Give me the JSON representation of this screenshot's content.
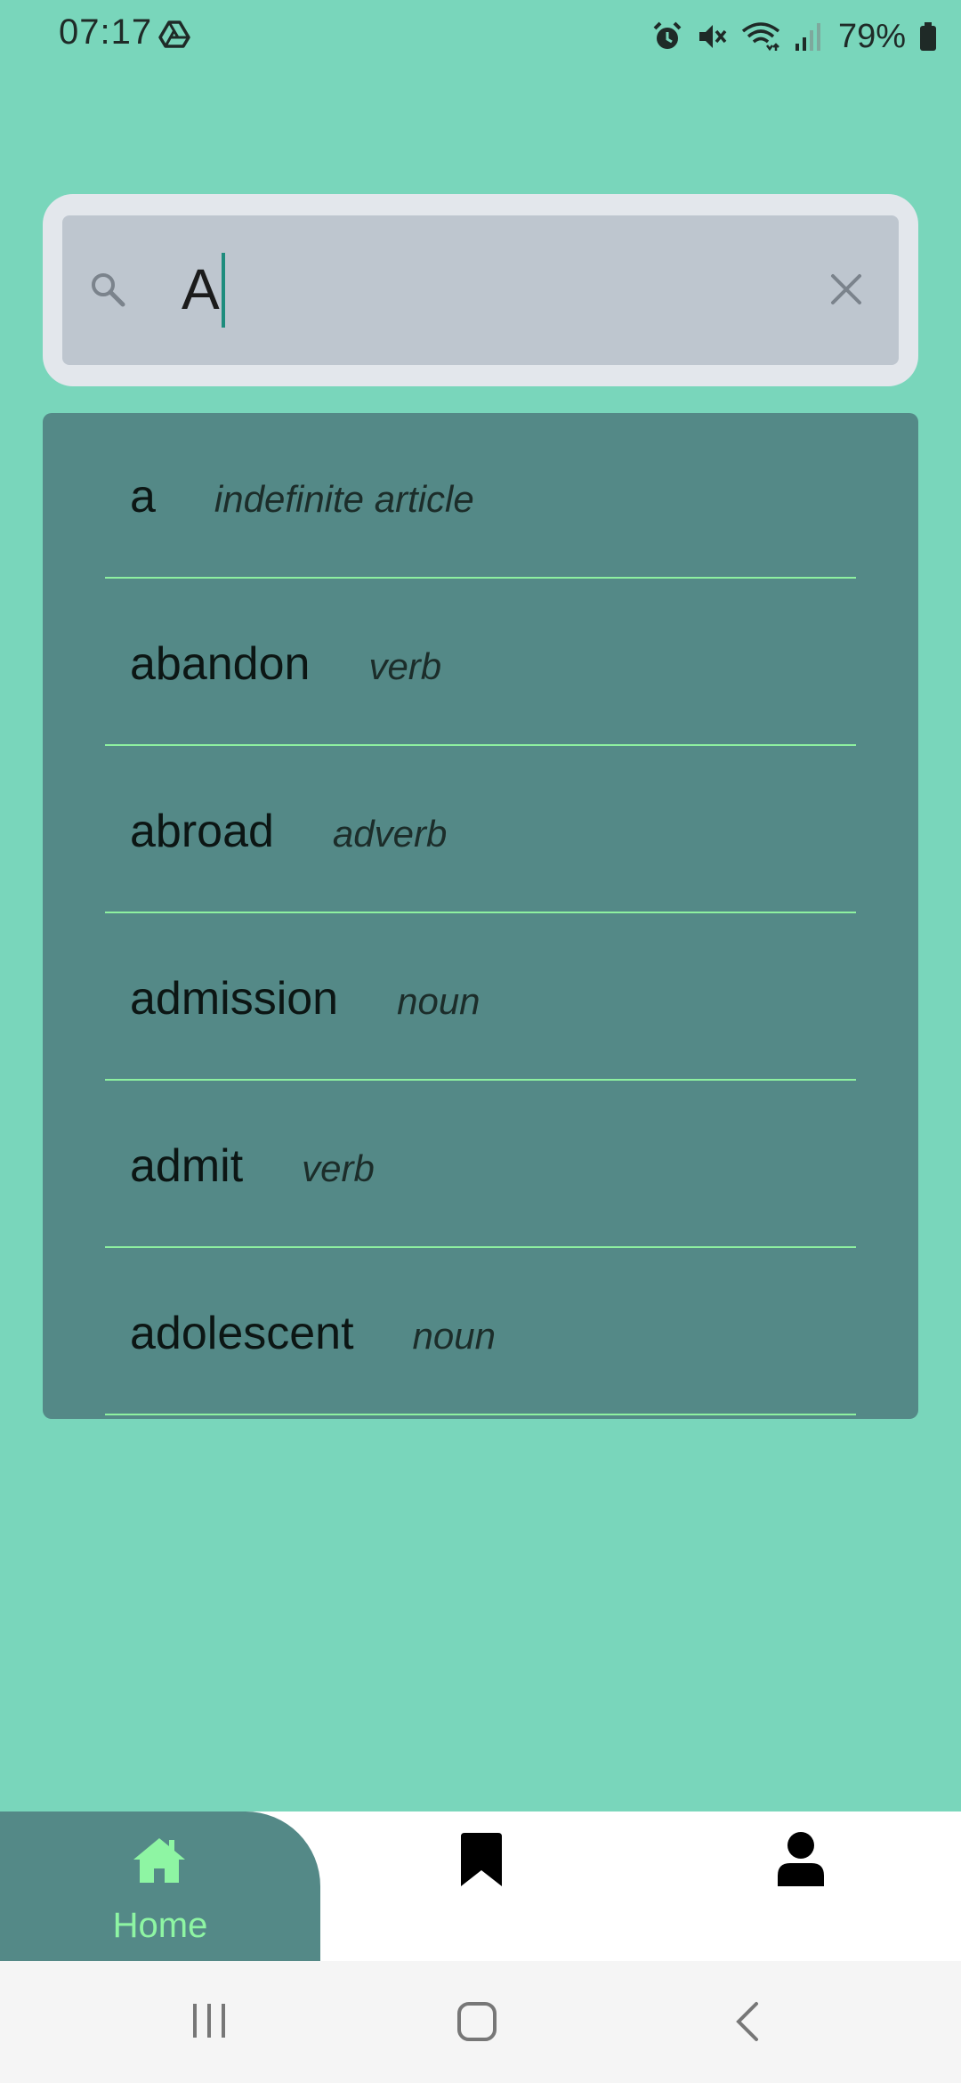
{
  "status_bar": {
    "time": "07:17",
    "battery": "79%",
    "icons": [
      "drive-icon",
      "alarm-icon",
      "mute-icon",
      "wifi-icon",
      "signal-icon",
      "battery-icon"
    ]
  },
  "search": {
    "value": "A",
    "icons": [
      "search-icon",
      "clear-icon"
    ]
  },
  "results": [
    {
      "word": "a",
      "pos": "indefinite article"
    },
    {
      "word": "abandon",
      "pos": "verb"
    },
    {
      "word": "abroad",
      "pos": "adverb"
    },
    {
      "word": "admission",
      "pos": "noun"
    },
    {
      "word": "admit",
      "pos": "verb"
    },
    {
      "word": "adolescent",
      "pos": "noun"
    }
  ],
  "bottom_nav": {
    "home_label": "Home",
    "items": [
      "home-icon",
      "bookmark-icon",
      "profile-icon"
    ],
    "active_color": "#8ef5a3",
    "active_bg": "#548987"
  },
  "colors": {
    "background": "#79d6bb",
    "panel": "#548987",
    "divider": "#8ef1a0"
  }
}
